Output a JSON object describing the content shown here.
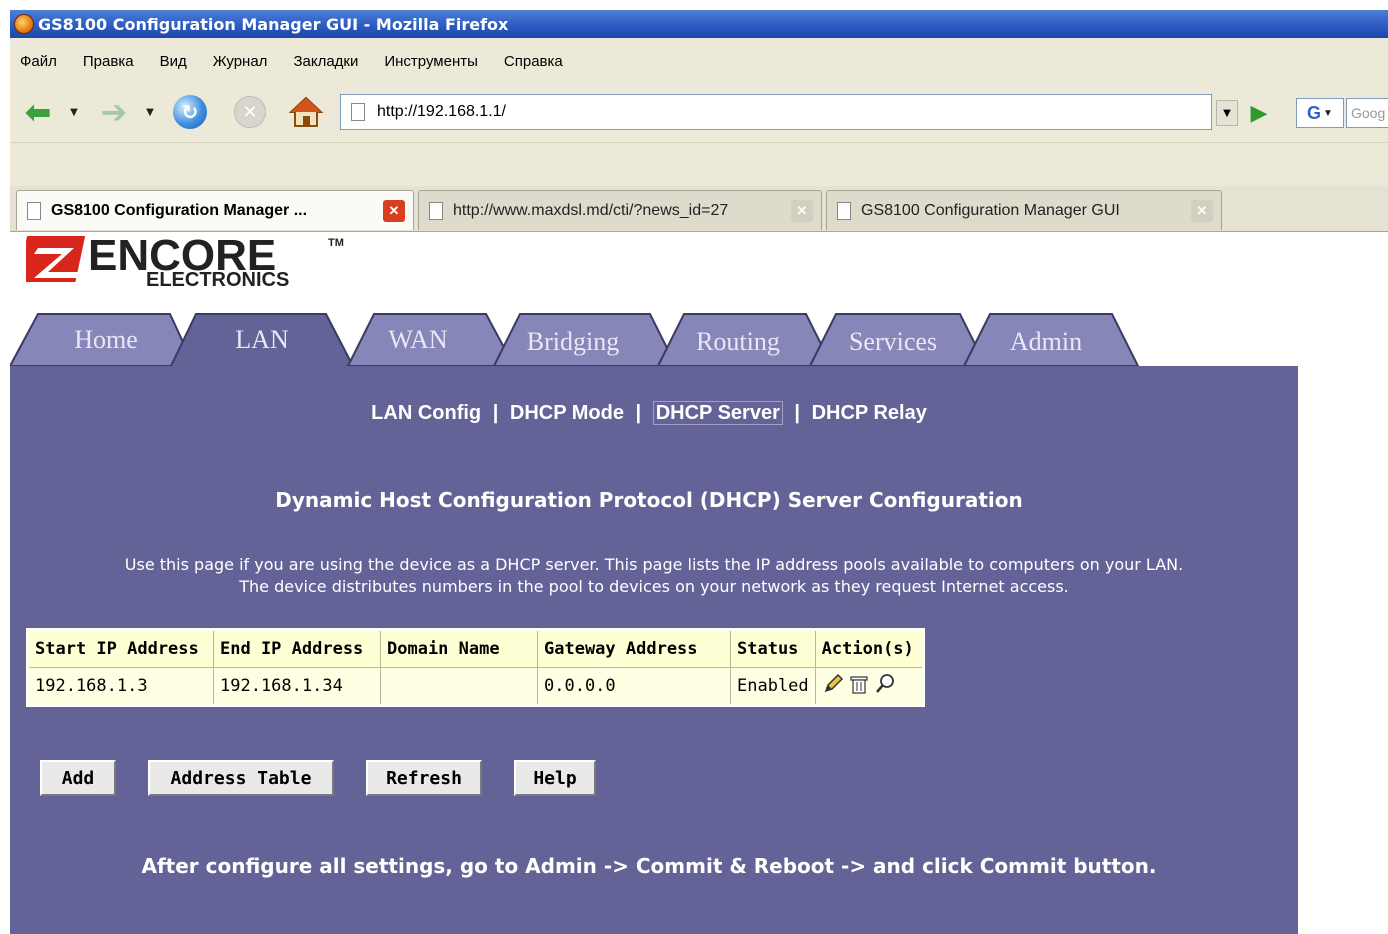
{
  "browser": {
    "window_title": "GS8100 Configuration Manager GUI - Mozilla Firefox",
    "menu": [
      "Файл",
      "Правка",
      "Вид",
      "Журнал",
      "Закладки",
      "Инструменты",
      "Справка"
    ],
    "url": "http://192.168.1.1/",
    "search_placeholder": "Goog",
    "search_engine_icon": "G",
    "tabs": [
      {
        "title": "GS8100 Configuration Manager ...",
        "active": true
      },
      {
        "title": "http://www.maxdsl.md/cti/?news_id=27",
        "active": false
      },
      {
        "title": "GS8100 Configuration Manager GUI",
        "active": false
      }
    ]
  },
  "logo": {
    "brand": "ENCORE",
    "sub": "ELECTRONICS",
    "tm": "TM"
  },
  "main_tabs": [
    "Home",
    "LAN",
    "WAN",
    "Bridging",
    "Routing",
    "Services",
    "Admin"
  ],
  "active_main_tab": "LAN",
  "sub_nav": [
    "LAN Config",
    "DHCP Mode",
    "DHCP Server",
    "DHCP Relay"
  ],
  "active_sub_nav": "DHCP Server",
  "page_title": "Dynamic Host Configuration Protocol (DHCP) Server Configuration",
  "description_line1": "Use this page if you are using the device as a DHCP server. This page lists the IP address pools available to computers on your LAN.",
  "description_line2": "The device distributes numbers in the pool to devices on your network as they request Internet access.",
  "table": {
    "headers": [
      "Start IP Address",
      "End IP Address",
      "Domain Name",
      "Gateway Address",
      "Status",
      "Action(s)"
    ],
    "rows": [
      {
        "start_ip": "192.168.1.3",
        "end_ip": "192.168.1.34",
        "domain": "",
        "gateway": "0.0.0.0",
        "status": "Enabled"
      }
    ],
    "action_icons": [
      "edit-icon",
      "delete-icon",
      "view-icon"
    ]
  },
  "buttons": {
    "add": "Add",
    "address_table": "Address Table",
    "refresh": "Refresh",
    "help": "Help"
  },
  "footer_note": "After configure all settings, go to Admin -> Commit & Reboot -> and click Commit button.",
  "colors": {
    "panel": "#646398",
    "tab_inactive": "#8786b8",
    "table_bg": "#ffffd6",
    "logo_red": "#d9261c"
  }
}
